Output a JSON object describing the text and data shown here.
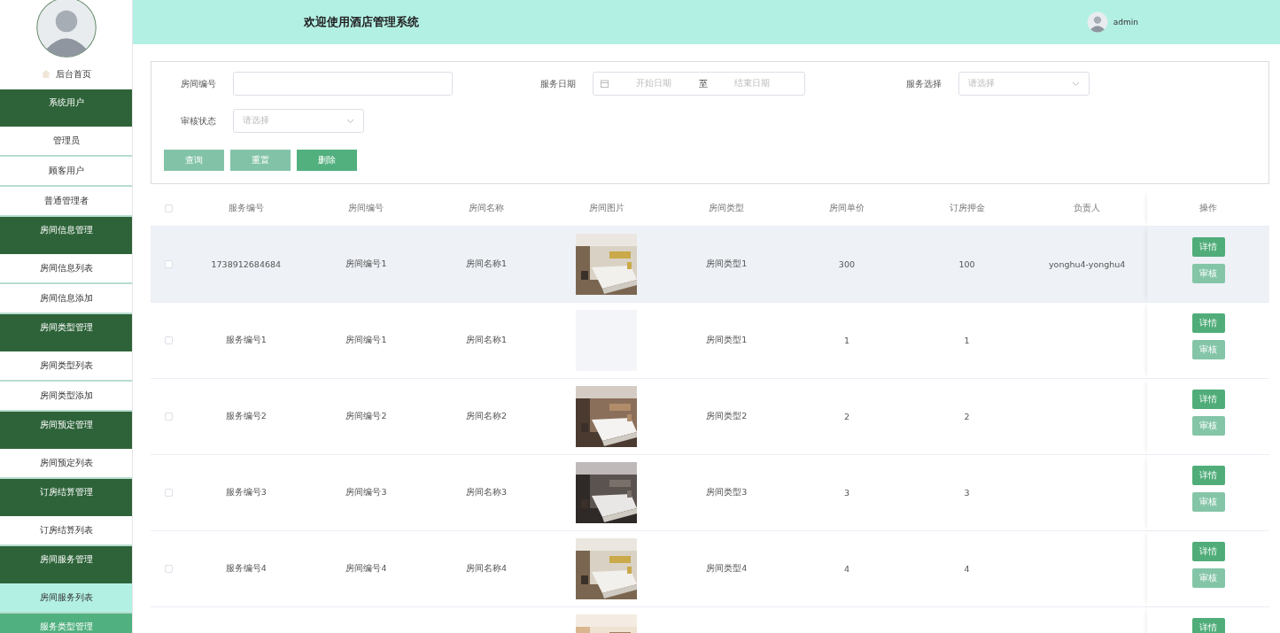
{
  "sidebar": {
    "home": "后台首页",
    "menu": [
      {
        "label": "系统用户",
        "hovered": false,
        "children": [
          {
            "label": "管理员",
            "selected": false
          },
          {
            "label": "顾客用户",
            "selected": false
          },
          {
            "label": "普通管理者",
            "selected": false
          }
        ]
      },
      {
        "label": "房间信息管理",
        "hovered": false,
        "children": [
          {
            "label": "房间信息列表",
            "selected": false
          },
          {
            "label": "房间信息添加",
            "selected": false
          }
        ]
      },
      {
        "label": "房间类型管理",
        "hovered": false,
        "children": [
          {
            "label": "房间类型列表",
            "selected": false
          },
          {
            "label": "房间类型添加",
            "selected": false
          }
        ]
      },
      {
        "label": "房间预定管理",
        "hovered": false,
        "children": [
          {
            "label": "房间预定列表",
            "selected": false
          }
        ]
      },
      {
        "label": "订房结算管理",
        "hovered": false,
        "children": [
          {
            "label": "订房结算列表",
            "selected": false
          }
        ]
      },
      {
        "label": "房间服务管理",
        "hovered": false,
        "children": [
          {
            "label": "房间服务列表",
            "selected": true
          }
        ]
      },
      {
        "label": "服务类型管理",
        "hovered": true
      }
    ]
  },
  "header": {
    "title": "欢迎使用酒店管理系统",
    "user": "admin"
  },
  "filters": {
    "fields": [
      {
        "kind": "text",
        "label": "房间编号"
      },
      {
        "kind": "daterange",
        "label": "服务日期",
        "start_placeholder": "开始日期",
        "separator": "至",
        "end_placeholder": "结束日期"
      },
      {
        "kind": "select",
        "label": "服务选择",
        "placeholder": "请选择"
      },
      {
        "kind": "select",
        "label": "审核状态",
        "placeholder": "请选择"
      }
    ],
    "buttons": [
      {
        "label": "查询",
        "kind": "light"
      },
      {
        "label": "重置",
        "kind": "light"
      },
      {
        "label": "删除",
        "kind": "solid"
      }
    ]
  },
  "table": {
    "select_all": {
      "checked": false
    },
    "columns": [
      "服务编号",
      "房间编号",
      "房间名称",
      "房间图片",
      "房间类型",
      "房间单价",
      "订房押金",
      "负责人",
      "操作"
    ],
    "rows": [
      {
        "hovered": true,
        "checked": false,
        "cells": [
          "1738912684684",
          "房间编号1",
          "房间名称1",
          "",
          "房间类型1",
          "300",
          "100",
          "yonghu4-yonghu4"
        ],
        "has_picture": true,
        "actions": [
          {
            "label": "详情",
            "kind": "primary"
          },
          {
            "label": "审核",
            "kind": "secondary"
          }
        ]
      },
      {
        "hovered": false,
        "checked": false,
        "cells": [
          "服务编号1",
          "房间编号1",
          "房间名称1",
          "",
          "房间类型1",
          "1",
          "1",
          ""
        ],
        "has_picture": false,
        "actions": [
          {
            "label": "详情",
            "kind": "primary"
          },
          {
            "label": "审核",
            "kind": "secondary"
          }
        ]
      },
      {
        "hovered": false,
        "checked": false,
        "cells": [
          "服务编号2",
          "房间编号2",
          "房间名称2",
          "",
          "房间类型2",
          "2",
          "2",
          ""
        ],
        "has_picture": true,
        "actions": [
          {
            "label": "详情",
            "kind": "primary"
          },
          {
            "label": "审核",
            "kind": "secondary"
          }
        ]
      },
      {
        "hovered": false,
        "checked": false,
        "cells": [
          "服务编号3",
          "房间编号3",
          "房间名称3",
          "",
          "房间类型3",
          "3",
          "3",
          ""
        ],
        "has_picture": true,
        "actions": [
          {
            "label": "详情",
            "kind": "primary"
          },
          {
            "label": "审核",
            "kind": "secondary"
          }
        ]
      },
      {
        "hovered": false,
        "checked": false,
        "cells": [
          "服务编号4",
          "房间编号4",
          "房间名称4",
          "",
          "房间类型4",
          "4",
          "4",
          ""
        ],
        "has_picture": true,
        "actions": [
          {
            "label": "详情",
            "kind": "primary"
          },
          {
            "label": "审核",
            "kind": "secondary"
          }
        ]
      },
      {
        "has_picture": true,
        "actions": [
          {
            "label": "详情",
            "kind": "primary"
          }
        ]
      }
    ]
  }
}
